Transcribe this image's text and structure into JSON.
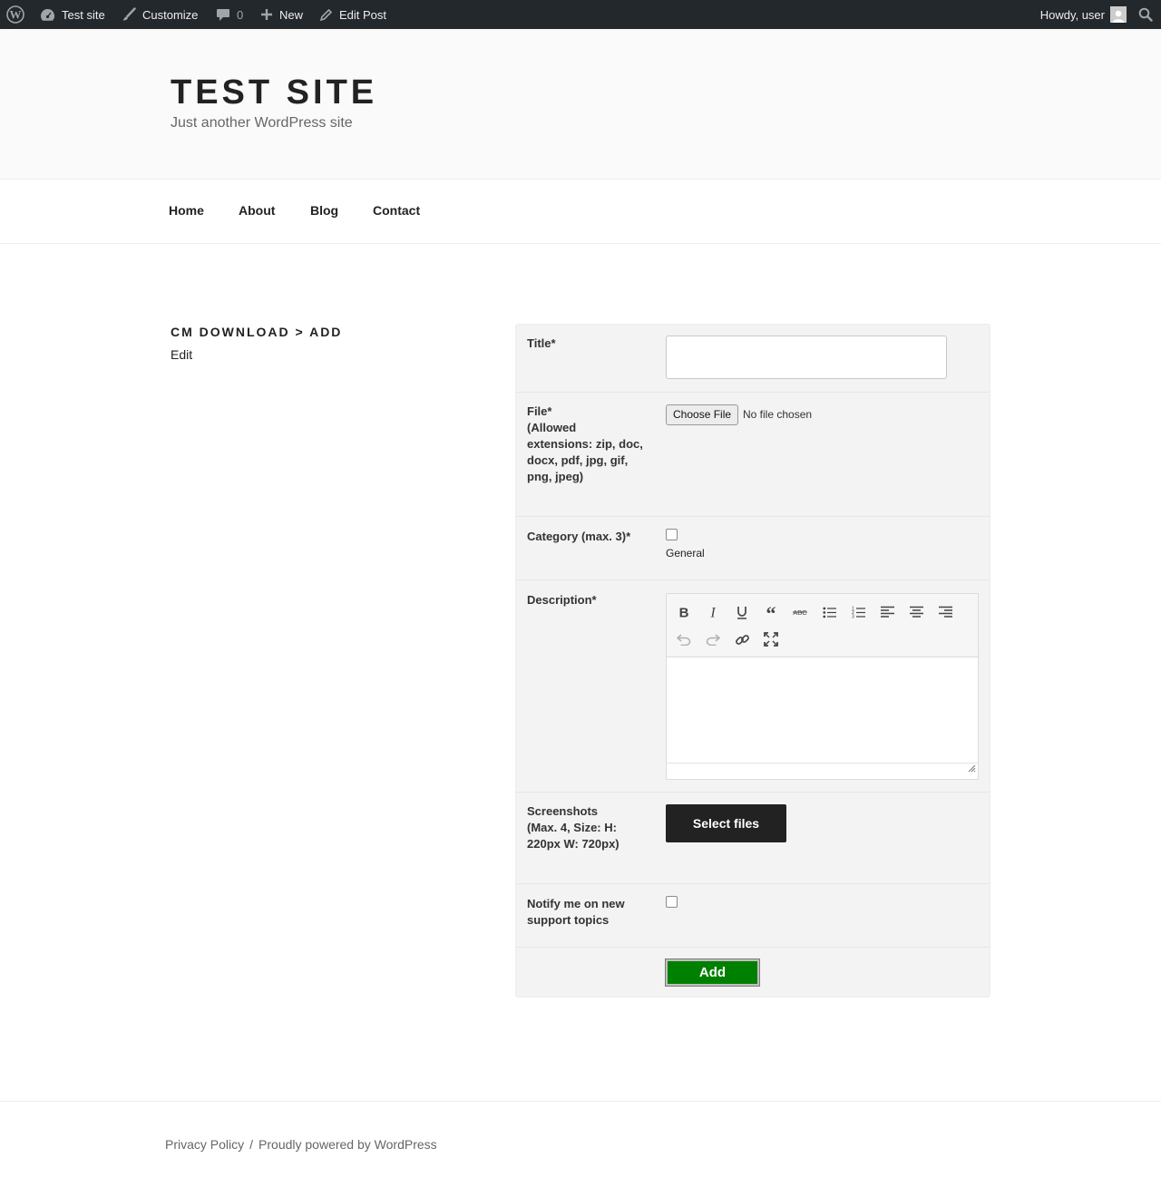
{
  "adminbar": {
    "site_name": "Test site",
    "customize": "Customize",
    "comments_count": "0",
    "new": "New",
    "edit_post": "Edit Post",
    "howdy": "Howdy, user"
  },
  "header": {
    "title": "TEST SITE",
    "description": "Just another WordPress site"
  },
  "nav": {
    "items": [
      {
        "label": "Home"
      },
      {
        "label": "About"
      },
      {
        "label": "Blog"
      },
      {
        "label": "Contact"
      }
    ]
  },
  "page": {
    "heading": "CM DOWNLOAD > ADD",
    "edit_link": "Edit"
  },
  "form": {
    "title_label": "Title*",
    "title_value": "",
    "file_label": "File*\n(Allowed extensions: zip, doc, docx, pdf, jpg, gif, png, jpeg)",
    "file_button": "Choose File",
    "file_status": "No file chosen",
    "category_label": "Category (max. 3)*",
    "categories": [
      {
        "name": "General",
        "checked": false
      }
    ],
    "description_label": "Description*",
    "description_value": "",
    "screenshots_label": "Screenshots\n(Max. 4, Size: H: 220px W: 720px)",
    "select_files": "Select files",
    "notify_label": "Notify me on new support topics",
    "notify_checked": false,
    "submit": "Add"
  },
  "editor_toolbar": [
    "bold-icon",
    "italic-icon",
    "underline-icon",
    "blockquote-icon",
    "strikethrough-icon",
    "bullet-list-icon",
    "numbered-list-icon",
    "align-left-icon",
    "align-center-icon",
    "align-right-icon",
    "undo-icon",
    "redo-icon",
    "link-icon",
    "fullscreen-icon"
  ],
  "footer": {
    "privacy": "Privacy Policy",
    "separator": "/",
    "powered": "Proudly powered by WordPress"
  },
  "colors": {
    "adminbar_bg": "#23282d",
    "add_button": "#008000",
    "select_files_button": "#222222"
  }
}
